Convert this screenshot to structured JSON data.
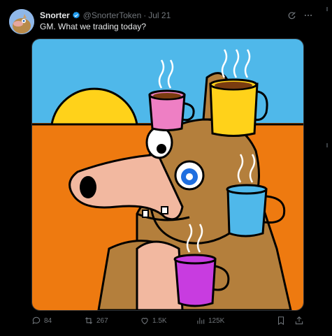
{
  "post": {
    "author_name": "Snorter",
    "author_handle": "@SnorterToken",
    "separator": "·",
    "date": "Jul 21",
    "text": "GM. What we trading today?"
  },
  "actions": {
    "replies": "84",
    "reposts": "267",
    "likes": "1.5K",
    "views": "125K"
  },
  "colors": {
    "verified": "#1d9bf0",
    "muted": "#71767b",
    "text": "#e7e9ea",
    "background": "#000000"
  },
  "icons": {
    "verified": "verified-badge-icon",
    "grok": "grok-icon",
    "more": "more-icon",
    "reply": "reply-icon",
    "repost": "repost-icon",
    "like": "heart-icon",
    "views": "views-icon",
    "bookmark": "bookmark-icon",
    "share": "share-icon"
  }
}
